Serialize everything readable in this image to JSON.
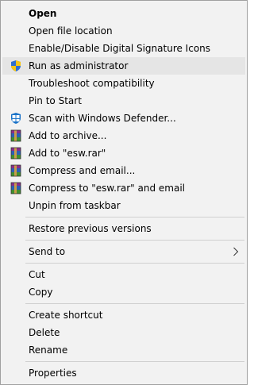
{
  "menu": {
    "items": [
      {
        "label": "Open"
      },
      {
        "label": "Open file location"
      },
      {
        "label": "Enable/Disable Digital Signature Icons"
      },
      {
        "label": "Run as administrator",
        "icon": "uac-shield-icon"
      },
      {
        "label": "Troubleshoot compatibility"
      },
      {
        "label": "Pin to Start"
      },
      {
        "label": "Scan with Windows Defender...",
        "icon": "windows-defender-icon"
      },
      {
        "label": "Add to archive...",
        "icon": "winrar-icon"
      },
      {
        "label": "Add to \"esw.rar\"",
        "icon": "winrar-icon"
      },
      {
        "label": "Compress and email...",
        "icon": "winrar-icon"
      },
      {
        "label": "Compress to \"esw.rar\" and email",
        "icon": "winrar-icon"
      },
      {
        "label": "Unpin from taskbar"
      },
      {
        "label": "Restore previous versions"
      },
      {
        "label": "Send to",
        "submenu": true,
        "submenu_icon": "chevron-right-icon"
      },
      {
        "label": "Cut"
      },
      {
        "label": "Copy"
      },
      {
        "label": "Create shortcut"
      },
      {
        "label": "Delete"
      },
      {
        "label": "Rename"
      },
      {
        "label": "Properties"
      }
    ]
  },
  "colors": {
    "menu_background": "#f2f2f2",
    "hover_background": "#e5e5e5",
    "separator": "#d0d0d0",
    "border": "#a0a0a0"
  }
}
